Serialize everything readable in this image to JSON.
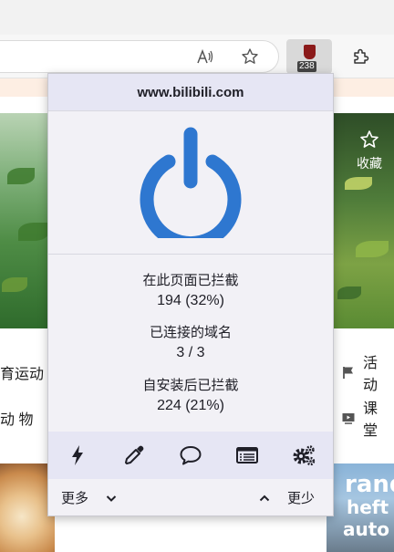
{
  "browser": {
    "ublock_badge": "238",
    "icons": [
      "read-aloud-icon",
      "favorite-star-icon",
      "ublock-shield-icon",
      "extensions-puzzle-icon"
    ]
  },
  "page": {
    "favorite_label": "收藏",
    "left_labels": [
      "育运动",
      "动 物"
    ],
    "right_labels": [
      "活 动",
      "课 堂"
    ],
    "thumbnail_text": [
      "rand",
      "heft",
      "auto"
    ]
  },
  "popup": {
    "hostname": "www.bilibili.com",
    "power_state": "enabled",
    "accent_color": "#2e77d0",
    "stats": {
      "blocked_on_page_label": "在此页面已拦截",
      "blocked_on_page_value": "194 (32%)",
      "domains_connected_label": "已连接的域名",
      "domains_connected_value": "3 / 3",
      "blocked_since_install_label": "自安装后已拦截",
      "blocked_since_install_value": "224 (21%)"
    },
    "tools": [
      "lightning-icon",
      "eyedropper-icon",
      "speech-bubble-icon",
      "logger-list-icon",
      "settings-gears-icon"
    ],
    "more_label": "更多",
    "less_label": "更少"
  }
}
